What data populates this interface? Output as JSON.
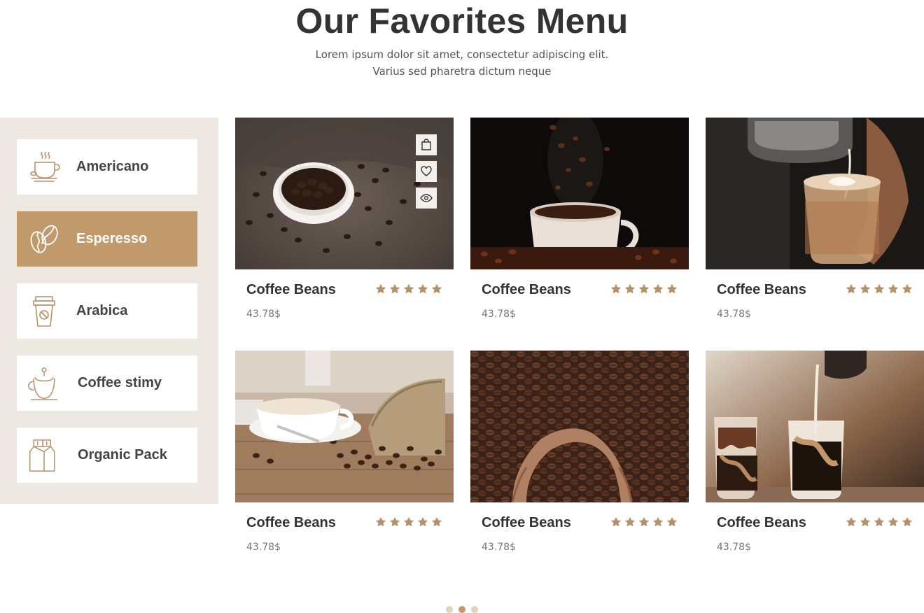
{
  "header": {
    "title": "Our Favorites Menu",
    "subtitle_line1": "Lorem ipsum dolor sit amet, consectetur adipiscing elit.",
    "subtitle_line2": "Varius sed pharetra dictum neque"
  },
  "theme": {
    "accent": "#c19a6b",
    "sidebar_bg": "#ede8e1",
    "text_dark": "#333333",
    "text_muted": "#777777"
  },
  "categories": [
    {
      "label": "Americano",
      "icon": "coffee-cup-steam-icon",
      "active": false
    },
    {
      "label": "Esperesso",
      "icon": "coffee-beans-icon",
      "active": true
    },
    {
      "label": "Arabica",
      "icon": "takeaway-cup-icon",
      "active": false
    },
    {
      "label": "Coffee stimy",
      "icon": "coffee-mug-icon",
      "active": false
    },
    {
      "label": "Organic Pack",
      "icon": "coffee-bag-icon",
      "active": false
    }
  ],
  "products": [
    {
      "title": "Coffee Beans",
      "price": "43.78$",
      "rating": 5,
      "image": "bowl-of-coffee-beans"
    },
    {
      "title": "Coffee Beans",
      "price": "43.78$",
      "rating": 5,
      "image": "beans-falling-into-cup"
    },
    {
      "title": "Coffee Beans",
      "price": "43.78$",
      "rating": 5,
      "image": "latte-art-pour"
    },
    {
      "title": "Coffee Beans",
      "price": "43.78$",
      "rating": 5,
      "image": "cup-and-bean-sack"
    },
    {
      "title": "Coffee Beans",
      "price": "43.78$",
      "rating": 5,
      "image": "hands-holding-beans"
    },
    {
      "title": "Coffee Beans",
      "price": "43.78$",
      "rating": 5,
      "image": "iced-coffee-glasses"
    }
  ],
  "card_actions": [
    "shopping-bag-icon",
    "heart-icon",
    "eye-icon"
  ],
  "pagination": {
    "count": 3,
    "active": 2
  }
}
